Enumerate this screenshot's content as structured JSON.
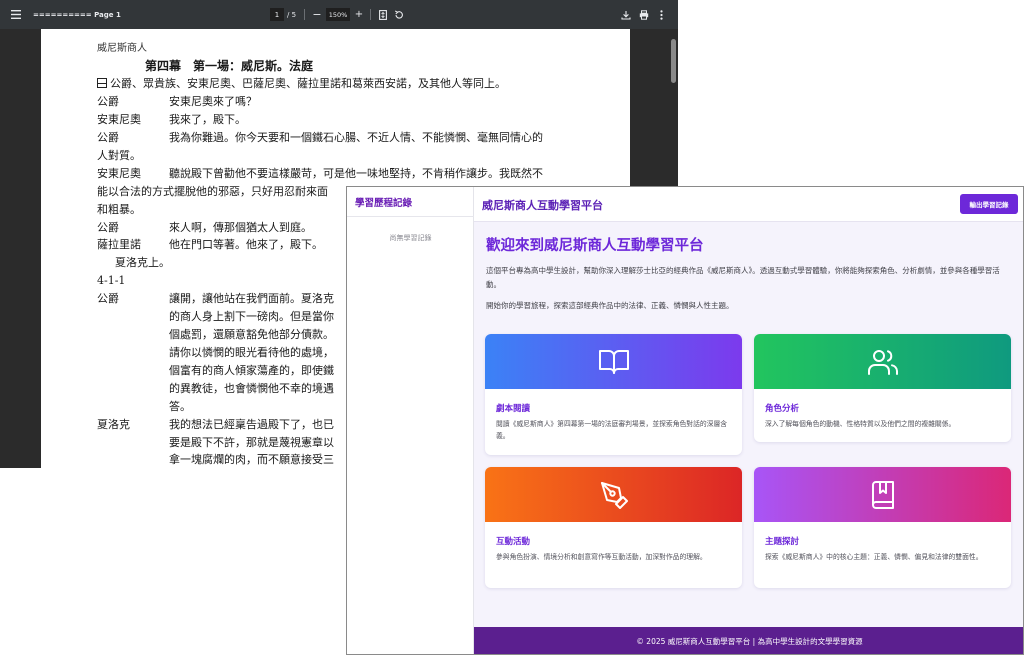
{
  "pdf_viewer": {
    "document_title": "========== Page 1",
    "current_page": "1",
    "page_separator": "/",
    "total_pages": "5",
    "zoom_out_symbol": "−",
    "zoom_level": "150%",
    "zoom_in_symbol": "+",
    "icons": [
      "menu-icon",
      "fit-page-icon",
      "rotate-icon",
      "download-icon",
      "print-icon",
      "more-options-icon"
    ],
    "page": {
      "header": "威尼斯商人",
      "scene_title": "第四幕　第一場：威尼斯。法庭",
      "stage_direction": "公爵、眾貴族、安東尼奧、巴薩尼奧、薩拉里諾和葛萊西安諾，及其他人等同上。",
      "lines": [
        {
          "speaker": "公爵",
          "text": "安東尼奧來了嗎？"
        },
        {
          "speaker": "安東尼奧",
          "text": "我來了，殿下。"
        },
        {
          "speaker": "公爵",
          "text": "我為你難過。你今天要和一個鐵石心腸、不近人情、不能憐憫、毫無同情心的"
        },
        {
          "speaker": "",
          "text": "人對質。"
        },
        {
          "speaker": "安東尼奧",
          "text": "聽說殿下曾勸他不要這樣嚴苛，可是他一味地堅持，不肯稍作讓步。我既然不"
        },
        {
          "speaker": "",
          "text": "能以合法的方式擺脫他的邪惡，只好用忍耐來面"
        },
        {
          "speaker": "",
          "text": "和粗暴。"
        },
        {
          "speaker": "公爵",
          "text": "來人啊，傳那個猶太人到庭。"
        },
        {
          "speaker": "薩拉里諾",
          "text": "他在門口等著。他來了，殿下。"
        }
      ],
      "shylock_enters": "夏洛克上。",
      "section_label": "4-1-1",
      "duke_speech": {
        "speaker": "公爵",
        "lines": [
          "讓開，讓他站在我們面前。夏洛克",
          "的商人身上割下一磅肉。但是當你",
          "個處罰，還願意豁免他部分債款。",
          "請你以憐憫的眼光看待他的處境，",
          "個富有的商人傾家蕩產的，即使鐵",
          "的異教徒，也會憐憫他不幸的境遇",
          "答。"
        ]
      },
      "shylock_speech": {
        "speaker": "夏洛克",
        "lines": [
          "我的想法已經稟告過殿下了，也已",
          "要是殿下不許，那就是蔑視憲章以",
          "拿一塊腐爛的肉，而不願意接受三"
        ]
      }
    }
  },
  "app": {
    "sidebar": {
      "title": "學習歷程記錄",
      "empty_text": "尚無學習記錄"
    },
    "header": {
      "title": "威尼斯商人互動學習平台",
      "export_button": "輸出學習記錄"
    },
    "welcome": {
      "title": "歡迎來到威尼斯商人互動學習平台",
      "intro": "這個平台專為高中學生設計，幫助你深入理解莎士比亞的經典作品《威尼斯商人》。透過互動式學習體驗，你將能夠探索角色、分析劇情，並參與各種學習活動。",
      "intro2": "開始你的學習旅程，探索這部經典作品中的法律、正義、憐憫與人性主題。"
    },
    "cards": [
      {
        "icon": "book-open-icon",
        "title": "劇本閱讀",
        "description": "閱讀《威尼斯商人》第四幕第一場的法庭審判場景，並探索角色對話的深層含義。",
        "gradient_from": "#3b82f6",
        "gradient_to": "#7c3aed"
      },
      {
        "icon": "users-icon",
        "title": "角色分析",
        "description": "深入了解每個角色的動機、性格特質以及他們之間的複雜關係。",
        "gradient_from": "#22c55e",
        "gradient_to": "#0f9a7f"
      },
      {
        "icon": "pen-tool-icon",
        "title": "互動活動",
        "description": "參與角色扮演、情境分析和創意寫作等互動活動，加深對作品的理解。",
        "gradient_from": "#f97316",
        "gradient_to": "#dc2626"
      },
      {
        "icon": "bookmark-book-icon",
        "title": "主題探討",
        "description": "探索《威尼斯商人》中的核心主題：正義、憐憫、偏見和法律的雙面性。",
        "gradient_from": "#a855f7",
        "gradient_to": "#db2777"
      }
    ],
    "footer": "© 2025 威尼斯商人互動學習平台 | 為高中學生設計的文學學習資源",
    "colors": {
      "accent": "#6d28d9",
      "footer_bg": "#5b1f8f",
      "main_bg": "#f5f3fc"
    }
  }
}
